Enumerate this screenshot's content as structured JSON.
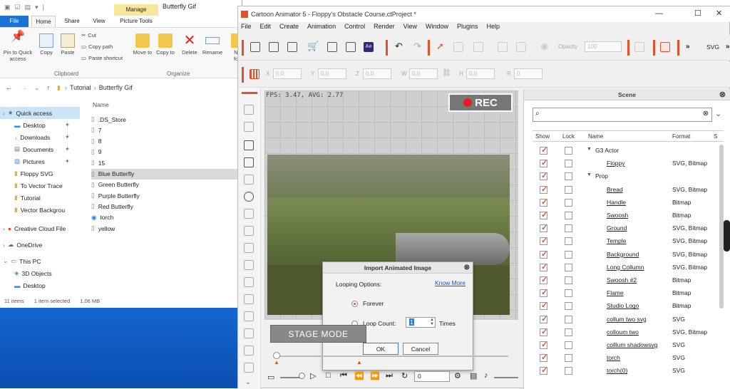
{
  "explorer": {
    "title": "Butterfly Gif",
    "tabs": {
      "file": "File",
      "home": "Home",
      "share": "Share",
      "view": "View",
      "manage": "Manage",
      "picture_tools": "Picture Tools"
    },
    "ribbon": {
      "pin": "Pin to Quick access",
      "copy": "Copy",
      "paste": "Paste",
      "cut": "Cut",
      "copy_path": "Copy path",
      "paste_shortcut": "Paste shortcut",
      "clipboard": "Clipboard",
      "move_to": "Move to",
      "copy_to": "Copy to",
      "delete": "Delete",
      "rename": "Rename",
      "new_partial": "N",
      "new_fo": "fo",
      "organize": "Organize"
    },
    "path": [
      "Tutorial",
      "Butterfly Gif"
    ],
    "nav": [
      "Quick access",
      "Desktop",
      "Downloads",
      "Documents",
      "Pictures",
      "Floppy SVG",
      "To Vector Trace",
      "Tutorial",
      "Vector Backgrou",
      "Creative Cloud File",
      "OneDrive",
      "This PC",
      "3D Objects",
      "Desktop"
    ],
    "name_header": "Name",
    "files": [
      ".DS_Store",
      "7",
      "8",
      "9",
      "15",
      "Blue Butterfly",
      "Green Butterfly",
      "Purple Butterfly",
      "Red Butterfly",
      "torch",
      "yellow"
    ],
    "status": {
      "count": "11 items",
      "selected": "1 item selected",
      "size": "1.06 MB"
    }
  },
  "ca": {
    "title": "Cartoon Animator 5 - Floppy's Obstacle Course.ctProject *",
    "menu": [
      "File",
      "Edit",
      "Create",
      "Animation",
      "Control",
      "Render",
      "View",
      "Window",
      "Plugins",
      "Help"
    ],
    "opacity_label": "Opacity",
    "opacity_value": "100",
    "svg_label": "SVG",
    "transform": {
      "x": "X",
      "y": "Y",
      "z": "Z",
      "w": "W",
      "h": "H",
      "r": "R",
      "zero": "0.0",
      "zero_int": "0"
    },
    "fps": "FPS: 3.47, AVG: 2.77",
    "rec": "REC",
    "stage_mode": "STAGE MODE",
    "frame": "0",
    "dialog": {
      "title": "Import Animated Image",
      "looping": "Looping Options:",
      "know_more": "Know More",
      "forever": "Forever",
      "loop_count": "Loop Count:",
      "count_value": "1",
      "times": "Times",
      "ok": "OK",
      "cancel": "Cancel"
    },
    "scene": {
      "title": "Scene",
      "cols": {
        "show": "Show",
        "lock": "Lock",
        "name": "Name",
        "format": "Format",
        "s": "S"
      },
      "rows": [
        {
          "name": "G3 Actor",
          "format": "",
          "group": true
        },
        {
          "name": "Floppy",
          "format": "SVG, Bitmap",
          "group": false
        },
        {
          "name": "Prop",
          "format": "",
          "group": true
        },
        {
          "name": "Bread",
          "format": "SVG, Bitmap",
          "group": false
        },
        {
          "name": "Handle",
          "format": "Bitmap",
          "group": false
        },
        {
          "name": "Swoosh",
          "format": "Bitmap",
          "group": false
        },
        {
          "name": "Ground",
          "format": "SVG, Bitmap",
          "group": false
        },
        {
          "name": "Temple",
          "format": "SVG, Bitmap",
          "group": false
        },
        {
          "name": "Background",
          "format": "SVG, Bitmap",
          "group": false
        },
        {
          "name": "Long Collumn",
          "format": "SVG, Bitmap",
          "group": false
        },
        {
          "name": "Swoosh #2",
          "format": "Bitmap",
          "group": false
        },
        {
          "name": "Flame",
          "format": "Bitmap",
          "group": false
        },
        {
          "name": "Studio Logo",
          "format": "Bitmap",
          "group": false
        },
        {
          "name": "collum two svg",
          "format": "SVG",
          "group": false
        },
        {
          "name": "colloum two",
          "format": "SVG, Bitmap",
          "group": false
        },
        {
          "name": "colllum shadowsvg",
          "format": "SVG",
          "group": false
        },
        {
          "name": "torch",
          "format": "SVG",
          "group": false
        },
        {
          "name": "torch(0)",
          "format": "SVG",
          "group": false
        }
      ]
    }
  }
}
